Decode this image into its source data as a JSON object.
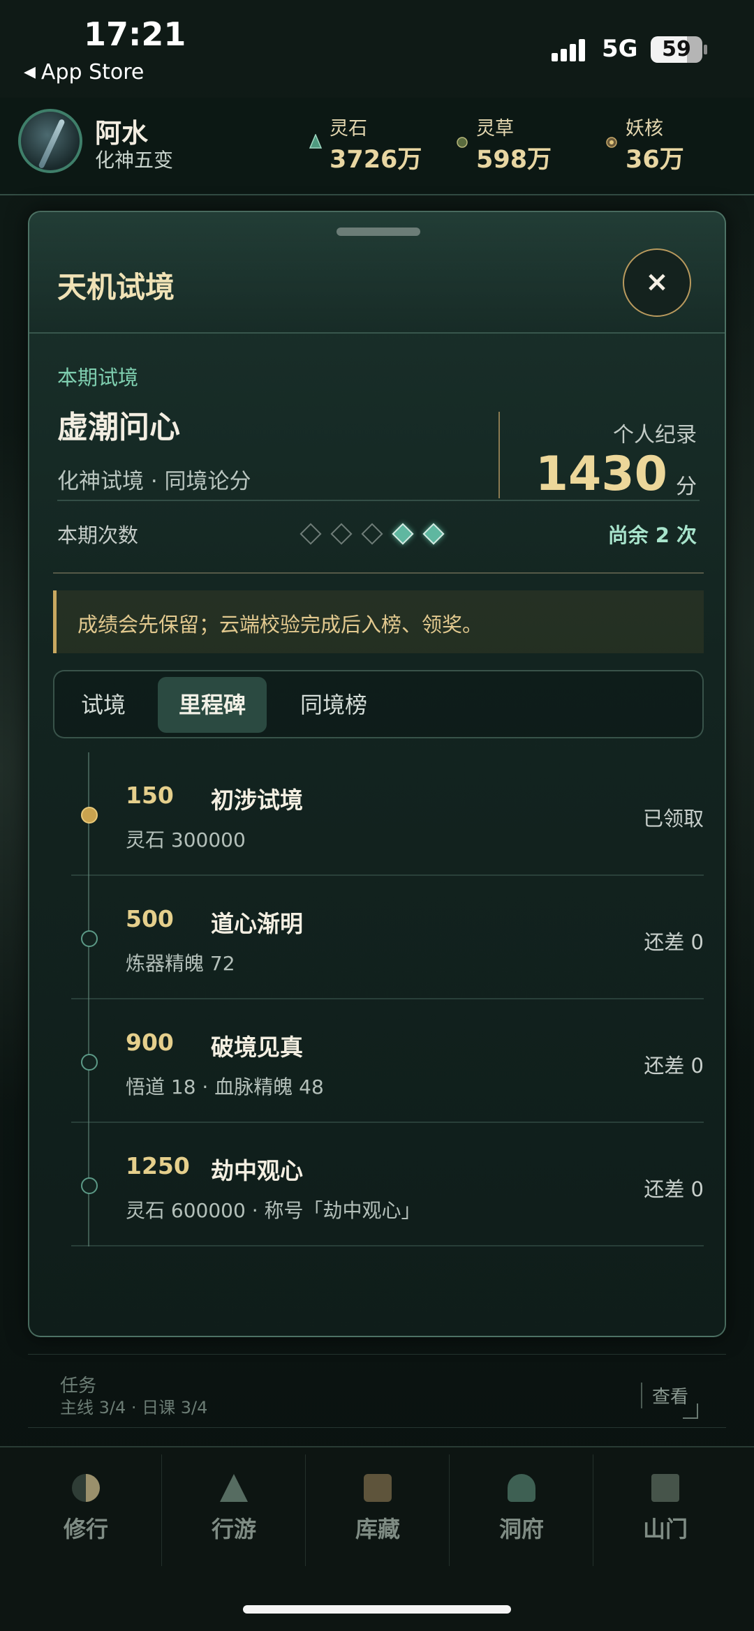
{
  "status_bar": {
    "time": "17:21",
    "back_app": "App Store",
    "network": "5G",
    "battery": "59"
  },
  "header": {
    "player_name": "阿水",
    "player_rank": "化神五变",
    "resources": [
      {
        "label": "灵石",
        "value": "3726万",
        "icon": "spirit-stone-icon"
      },
      {
        "label": "灵草",
        "value": "598万",
        "icon": "spirit-herb-icon"
      },
      {
        "label": "妖核",
        "value": "36万",
        "icon": "demon-core-icon"
      }
    ]
  },
  "panel": {
    "title": "天机试境",
    "close_label": "×",
    "period_label": "本期试境",
    "trial_name": "虚潮问心",
    "trial_subtitle": "化神试境 · 同境论分",
    "record_label": "个人纪录",
    "record_value": "1430",
    "record_unit": "分",
    "count_label": "本期次数",
    "attempts_total": 5,
    "attempts_remaining": 2,
    "remaining_text": "尚余 2 次",
    "notice": "成绩会先保留；云端校验完成后入榜、领奖。",
    "tabs": [
      {
        "label": "试境",
        "active": false
      },
      {
        "label": "里程碑",
        "active": true
      },
      {
        "label": "同境榜",
        "active": false
      }
    ],
    "milestones": [
      {
        "score": "150",
        "name": "初涉试境",
        "reward": "灵石 300000",
        "status": "已领取",
        "done": true
      },
      {
        "score": "500",
        "name": "道心渐明",
        "reward": "炼器精魄 72",
        "status": "还差 0",
        "done": false
      },
      {
        "score": "900",
        "name": "破境见真",
        "reward": "悟道 18 · 血脉精魄 48",
        "status": "还差 0",
        "done": false
      },
      {
        "score": "1250",
        "name": "劫中观心",
        "reward": "灵石 600000 · 称号「劫中观心」",
        "status": "还差 0",
        "done": false
      }
    ]
  },
  "behind": {
    "task_title": "任务",
    "task_detail": "主线 3/4 · 日课 3/4",
    "view_label": "查看"
  },
  "bottom_nav": [
    {
      "label": "修行",
      "icon": "yin-yang-icon"
    },
    {
      "label": "行游",
      "icon": "mountain-icon"
    },
    {
      "label": "库藏",
      "icon": "chest-icon"
    },
    {
      "label": "洞府",
      "icon": "cave-icon"
    },
    {
      "label": "山门",
      "icon": "gate-icon"
    }
  ],
  "colors": {
    "accent_gold": "#ecd79a",
    "accent_teal": "#7fcfb0",
    "panel_bg": "#132420"
  }
}
